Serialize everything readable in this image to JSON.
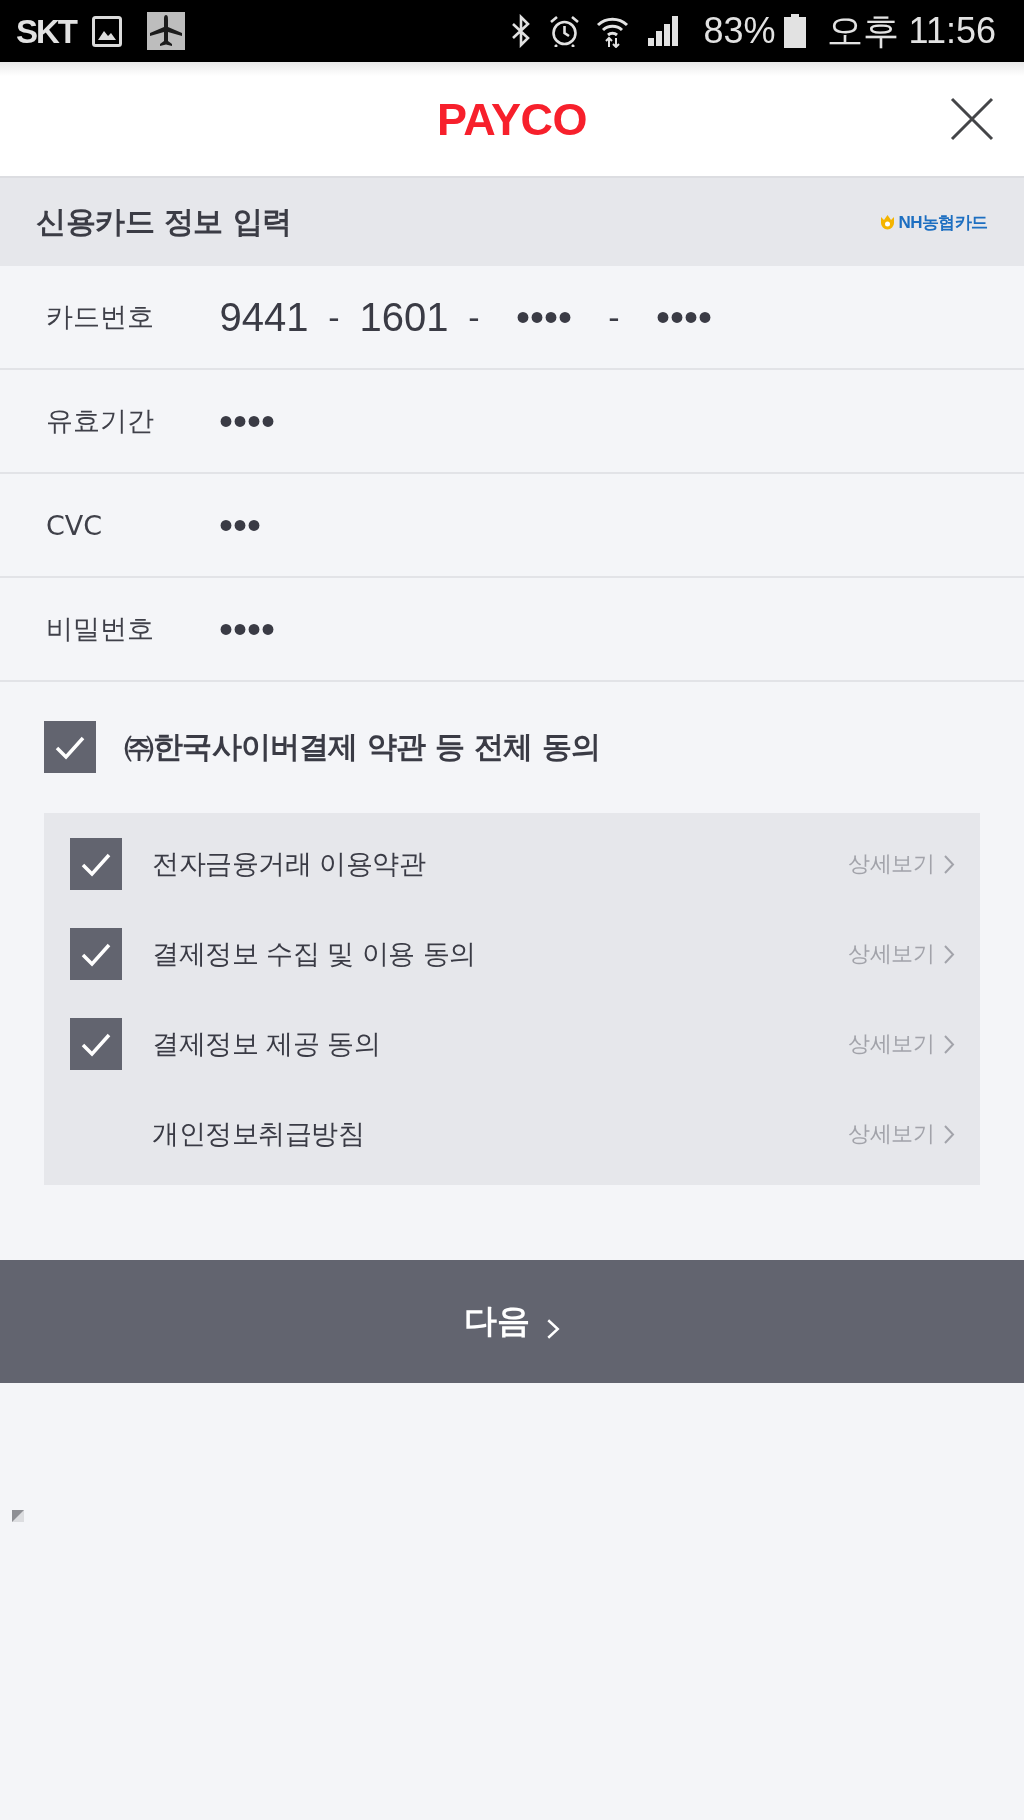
{
  "status_bar": {
    "carrier": "SKT",
    "battery_percent": "83%",
    "time": "오후 11:56"
  },
  "header": {
    "logo": "PAYCO"
  },
  "section": {
    "title": "신용카드 정보 입력",
    "card_brand": "NH농협카드"
  },
  "fields": [
    {
      "label": "카드번호",
      "kind": "segmented",
      "segments": [
        {
          "value": "9441",
          "separator": "-"
        },
        {
          "value": "1601",
          "separator": "-"
        },
        {
          "value": "••••",
          "separator": "-"
        },
        {
          "value": "••••"
        }
      ]
    },
    {
      "label": "유효기간",
      "kind": "single",
      "value": "••••"
    },
    {
      "label": "CVC",
      "kind": "single",
      "value": "•••"
    },
    {
      "label": "비밀번호",
      "kind": "single",
      "value": "••••"
    }
  ],
  "agreement": {
    "all": {
      "label": "㈜한국사이버결제 약관 등 전체 동의",
      "checked": true
    },
    "items": [
      {
        "kind": "checkbox",
        "label": "전자금융거래 이용약관",
        "checked": true,
        "link": "상세보기"
      },
      {
        "kind": "checkbox",
        "label": "결제정보 수집 및 이용 동의",
        "checked": true,
        "link": "상세보기"
      },
      {
        "kind": "checkbox",
        "label": "결제정보 제공 동의",
        "checked": true,
        "link": "상세보기"
      },
      {
        "kind": "plain",
        "label": "개인정보취급방침",
        "link": "상세보기"
      }
    ]
  },
  "next_button": {
    "label": "다음"
  }
}
